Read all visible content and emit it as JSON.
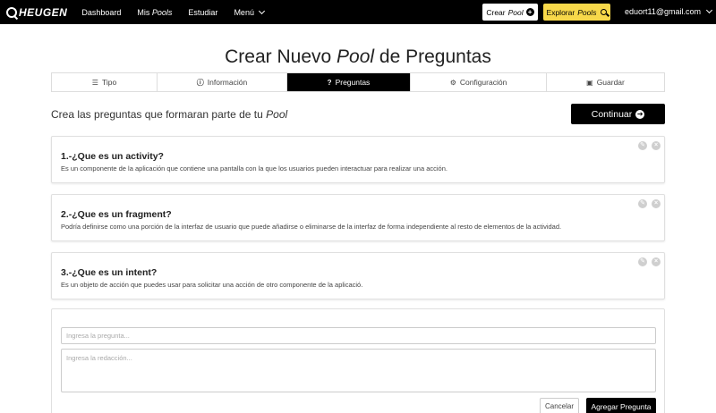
{
  "navbar": {
    "brand": "HEUGEN",
    "links": {
      "dashboard": "Dashboard",
      "my_pools_prefix": "Mis",
      "my_pools_em": "Pools",
      "study": "Estudiar",
      "menu": "Menú"
    },
    "create_button": {
      "prefix": "Crear",
      "em": "Pool"
    },
    "explore_button": {
      "prefix": "Explorar",
      "em": "Pools"
    },
    "user_email": "eduort11@gmail.com",
    "colors": {
      "bar": "#000000",
      "explore_accent": "#f7d84a"
    }
  },
  "page": {
    "title_prefix": "Crear Nuevo",
    "title_em": "Pool",
    "title_suffix": "de Preguntas",
    "subtitle_prefix": "Crea las preguntas que formaran parte de tu",
    "subtitle_em": "Pool",
    "continue_label": "Continuar"
  },
  "steps": [
    {
      "label": "Tipo",
      "icon": "list-icon",
      "active": false
    },
    {
      "label": "Información",
      "icon": "info-icon",
      "active": false
    },
    {
      "label": "Preguntas",
      "icon": "question-icon",
      "active": true
    },
    {
      "label": "Configuración",
      "icon": "gears-icon",
      "active": false
    },
    {
      "label": "Guardar",
      "icon": "save-icon",
      "active": false
    }
  ],
  "questions": [
    {
      "title": "1.-¿Que es un activity?",
      "description": "Es un componente de la aplicación que contiene una pantalla con la que los usuarios pueden interactuar para realizar una acción."
    },
    {
      "title": "2.-¿Que es un fragment?",
      "description": "Podría definirse como una porción de la interfaz de usuario que puede añadirse o eliminarse de la interfaz de forma independiente al resto de elementos de la actividad."
    },
    {
      "title": "3.-¿Que es un intent?",
      "description": "Es un objeto de acción que puedes usar para solicitar una acción de otro componente de la aplicació."
    }
  ],
  "form": {
    "question_placeholder": "Ingresa la pregunta...",
    "answer_placeholder": "Ingresa la redacción...",
    "cancel_label": "Cancelar",
    "add_label": "Agregar Pregunta"
  }
}
